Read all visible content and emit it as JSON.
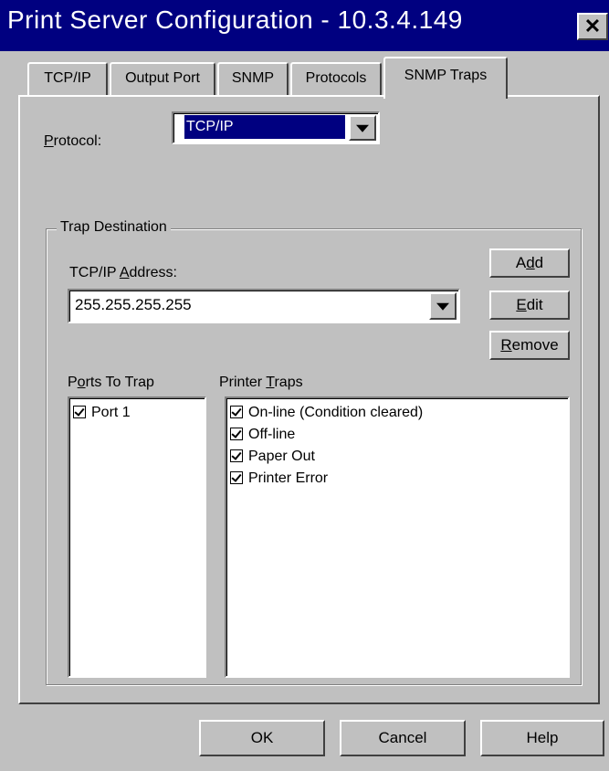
{
  "window": {
    "title": "Print Server Configuration - 10.3.4.149",
    "close_glyph": "✕"
  },
  "tabs": [
    {
      "label": "TCP/IP",
      "active": false
    },
    {
      "label": "Output Port",
      "active": false
    },
    {
      "label": "SNMP",
      "active": false
    },
    {
      "label": "Protocols",
      "active": false
    },
    {
      "label": "SNMP Traps",
      "active": true
    }
  ],
  "protocol": {
    "label_pre": "",
    "label_u": "P",
    "label_post": "rotocol:",
    "value": "TCP/IP"
  },
  "trap_destination": {
    "title": "Trap Destination",
    "address_label_pre": "TCP/IP ",
    "address_label_u": "A",
    "address_label_post": "ddress:",
    "address_value": "255.255.255.255",
    "buttons": {
      "add_pre": "A",
      "add_u": "d",
      "add_post": "d",
      "edit_pre": "",
      "edit_u": "E",
      "edit_post": "dit",
      "remove_pre": "",
      "remove_u": "R",
      "remove_post": "emove"
    }
  },
  "ports": {
    "label_pre": "P",
    "label_u": "o",
    "label_post": "rts To Trap",
    "items": [
      {
        "label": "Port 1",
        "checked": true
      }
    ]
  },
  "printer_traps": {
    "label_pre": "Printer ",
    "label_u": "T",
    "label_post": "raps",
    "items": [
      {
        "label": "On-line (Condition cleared)",
        "checked": true
      },
      {
        "label": "Off-line",
        "checked": true
      },
      {
        "label": "Paper Out",
        "checked": true
      },
      {
        "label": "Printer Error",
        "checked": true
      }
    ]
  },
  "footer": {
    "ok": "OK",
    "cancel": "Cancel",
    "help": "Help"
  }
}
